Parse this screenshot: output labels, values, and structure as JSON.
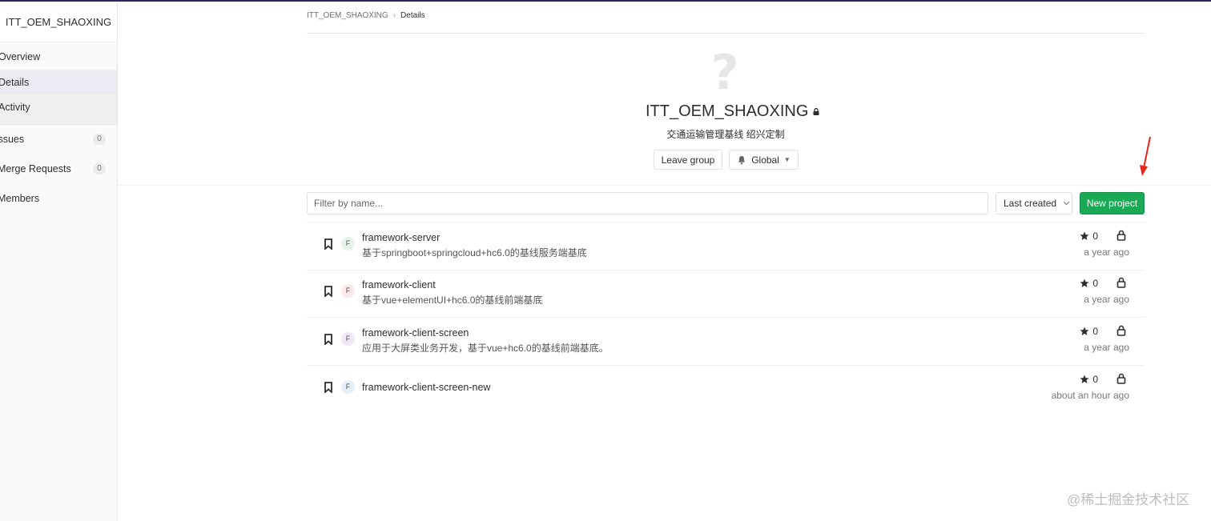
{
  "sidebar": {
    "group_name": "ITT_OEM_SHAOXING",
    "items": [
      {
        "label": "Overview"
      },
      {
        "label": "Details"
      },
      {
        "label": "Activity"
      },
      {
        "label": "Issues",
        "count": "0"
      },
      {
        "label": "Merge Requests",
        "count": "0"
      },
      {
        "label": "Members"
      }
    ]
  },
  "breadcrumb": {
    "root": "ITT_OEM_SHAOXING",
    "current": "Details"
  },
  "group": {
    "name": "ITT_OEM_SHAOXING",
    "description": "交通运输管理基线 绍兴定制",
    "leave_label": "Leave group",
    "notification_label": "Global"
  },
  "toolbar": {
    "filter_placeholder": "Filter by name...",
    "sort_label": "Last created",
    "new_project_label": "New project"
  },
  "projects": [
    {
      "initial": "F",
      "name": "framework-server",
      "description": "基于springboot+springcloud+hc6.0的基线服务端基底",
      "stars": "0",
      "updated": "a year ago",
      "avatar_color": "#e6f4ea"
    },
    {
      "initial": "F",
      "name": "framework-client",
      "description": "基于vue+elementUI+hc6.0的基线前端基底",
      "stars": "0",
      "updated": "a year ago",
      "avatar_color": "#fbe9eb"
    },
    {
      "initial": "F",
      "name": "framework-client-screen",
      "description": "应用于大屏类业务开发，基于vue+hc6.0的基线前端基底。",
      "stars": "0",
      "updated": "a year ago",
      "avatar_color": "#f1e8f6"
    },
    {
      "initial": "F",
      "name": "framework-client-screen-new",
      "description": "",
      "stars": "0",
      "updated": "about an hour ago",
      "avatar_color": "#e6f0fb"
    }
  ],
  "watermark": "@稀土掘金技术社区",
  "colors": {
    "accent": "#1aaa55",
    "top_bar": "#2b2661",
    "annotation_arrow": "#e8261f"
  }
}
